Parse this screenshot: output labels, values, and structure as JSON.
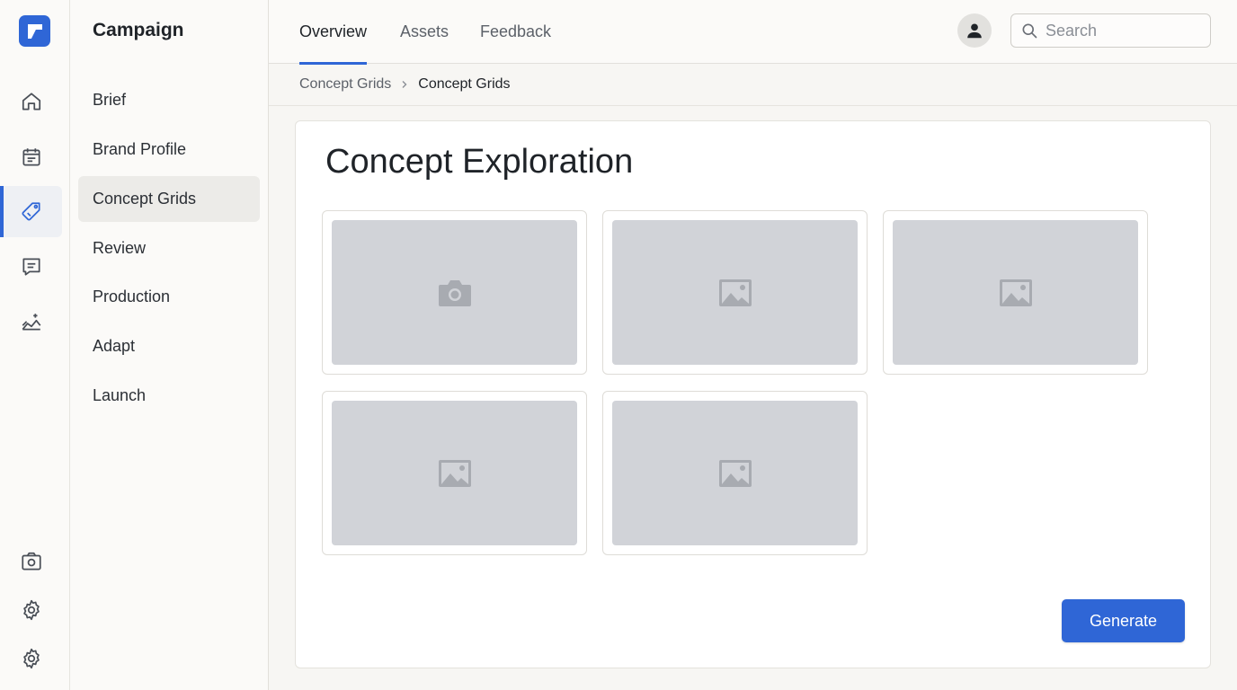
{
  "brand": {
    "accent": "#2f66d6",
    "logo_icon": "logo-icon"
  },
  "rail": {
    "items": [
      {
        "name": "home",
        "icon": "home-icon"
      },
      {
        "name": "calendar",
        "icon": "calendar-icon"
      },
      {
        "name": "tag",
        "icon": "tag-icon",
        "active": true
      },
      {
        "name": "comments",
        "icon": "comment-icon"
      },
      {
        "name": "insights",
        "icon": "sparkle-chart-icon"
      },
      {
        "name": "camera",
        "icon": "camera-icon"
      },
      {
        "name": "settings",
        "icon": "gear-icon"
      },
      {
        "name": "settings-alt",
        "icon": "gear-icon"
      }
    ]
  },
  "nav": {
    "title": "Campaign",
    "items": [
      {
        "label": "Brief"
      },
      {
        "label": "Brand Profile"
      },
      {
        "label": "Concept Grids",
        "active": true
      },
      {
        "label": "Review"
      },
      {
        "label": "Production"
      },
      {
        "label": "Adapt"
      },
      {
        "label": "Launch"
      }
    ]
  },
  "topbar": {
    "tabs": [
      {
        "label": "Overview",
        "active": true
      },
      {
        "label": "Assets"
      },
      {
        "label": "Feedback"
      }
    ],
    "search": {
      "placeholder": "Search",
      "value": ""
    }
  },
  "breadcrumb": {
    "parent": "Concept Grids",
    "current": "Concept Grids"
  },
  "main": {
    "title": "Concept Exploration",
    "tiles": [
      {
        "icon": "camera-icon"
      },
      {
        "icon": "image-icon"
      },
      {
        "icon": "image-icon"
      },
      {
        "icon": "image-icon"
      },
      {
        "icon": "image-icon"
      }
    ],
    "generate_label": "Generate"
  }
}
